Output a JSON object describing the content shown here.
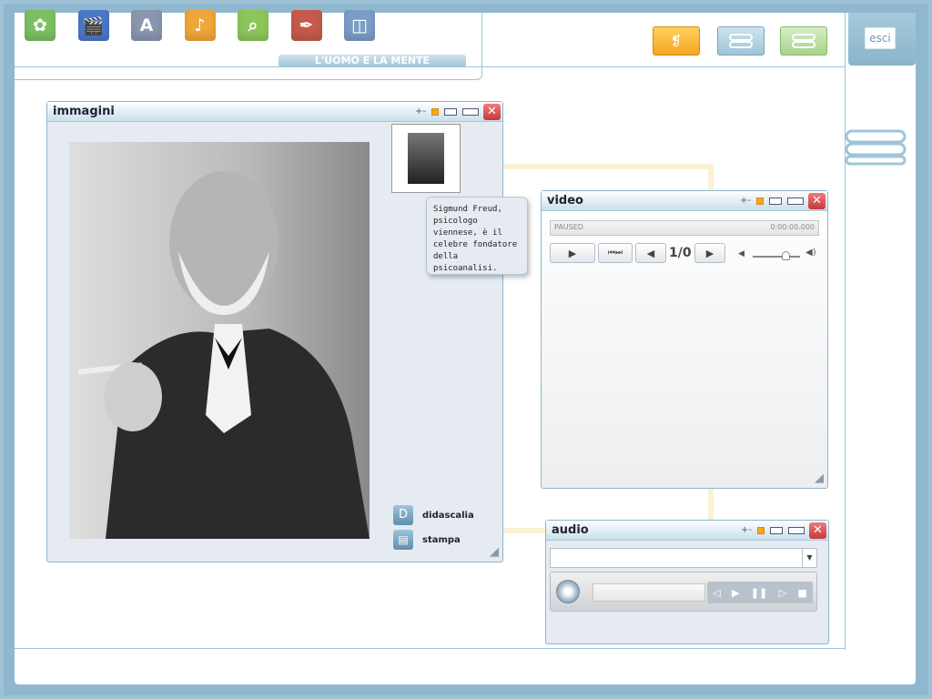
{
  "app": {
    "subtitle": "L'UOMO E LA MENTE",
    "exit_label": "esci"
  },
  "colors": {
    "accent": "#8fb8cf",
    "close": "#c63a3a"
  },
  "top_icons": [
    {
      "name": "butterfly-icon",
      "glyph": "✿",
      "color": "#7cbf63"
    },
    {
      "name": "clapperboard-icon",
      "glyph": "🎬",
      "color": "#4a78c8"
    },
    {
      "name": "letter-a-icon",
      "glyph": "A",
      "color": "#8a96b0"
    },
    {
      "name": "music-note-icon",
      "glyph": "♪",
      "color": "#efa63a"
    },
    {
      "name": "magnifier-icon",
      "glyph": "⌕",
      "color": "#8cc65a"
    },
    {
      "name": "quill-icon",
      "glyph": "✒",
      "color": "#c65a4a"
    },
    {
      "name": "speaker-icon",
      "glyph": "◫",
      "color": "#7a9dc6"
    }
  ],
  "images_window": {
    "title": "immagini",
    "caption": "Sigmund Freud, psicologo viennese, è il celebre fondatore della psicoanalisi.",
    "didascalia_label": "didascalia",
    "didascalia_icon_letter": "D",
    "stampa_label": "stampa"
  },
  "video_window": {
    "title": "video",
    "status": "PAUSED",
    "time": "0:00:00.000",
    "page_counter": "1/0"
  },
  "audio_window": {
    "title": "audio"
  }
}
